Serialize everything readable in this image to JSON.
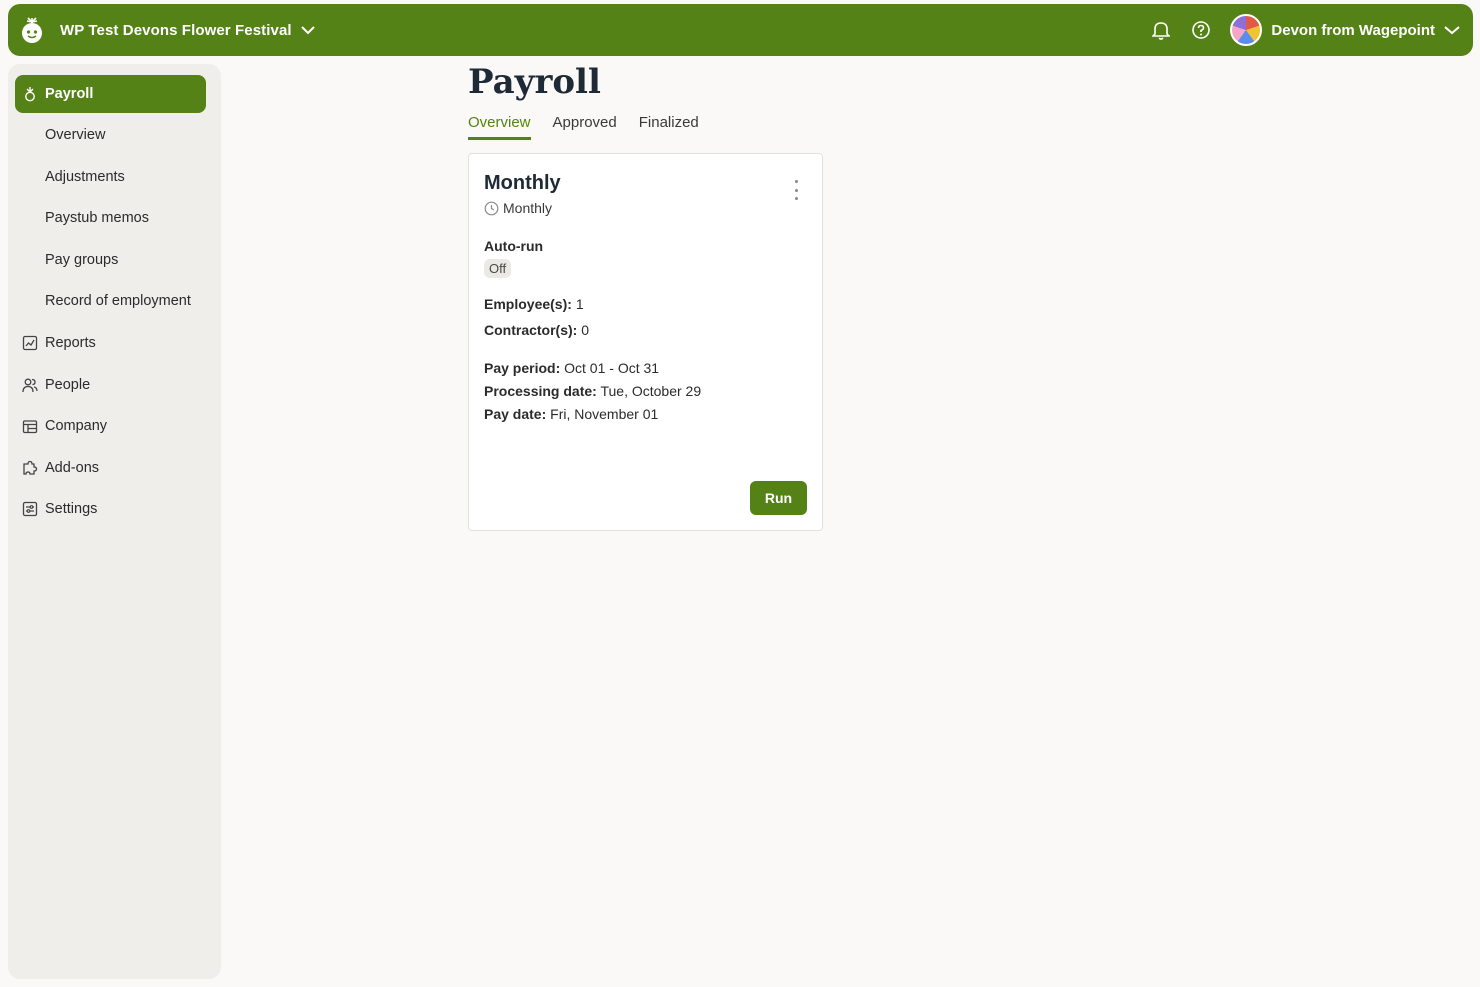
{
  "header": {
    "company_name": "WP Test Devons Flower Festival",
    "user_name": "Devon from Wagepoint",
    "brand_color": "#548216"
  },
  "sidebar": {
    "items": [
      {
        "label": "Payroll",
        "icon": "payroll-icon",
        "active": true
      },
      {
        "label": "Overview"
      },
      {
        "label": "Adjustments"
      },
      {
        "label": "Paystub memos"
      },
      {
        "label": "Pay groups"
      },
      {
        "label": "Record of employment"
      },
      {
        "label": "Reports",
        "icon": "reports-icon"
      },
      {
        "label": "People",
        "icon": "people-icon"
      },
      {
        "label": "Company",
        "icon": "company-icon"
      },
      {
        "label": "Add-ons",
        "icon": "addons-icon"
      },
      {
        "label": "Settings",
        "icon": "settings-icon"
      }
    ]
  },
  "main": {
    "title": "Payroll",
    "tabs": [
      {
        "label": "Overview",
        "active": true
      },
      {
        "label": "Approved"
      },
      {
        "label": "Finalized"
      }
    ],
    "card": {
      "title": "Monthly",
      "frequency": "Monthly",
      "autorun_label": "Auto-run",
      "autorun_value": "Off",
      "employees_label": "Employee(s):",
      "employees_value": "1",
      "contractors_label": "Contractor(s):",
      "contractors_value": "0",
      "pay_period_label": "Pay period:",
      "pay_period_value": "Oct 01 - Oct 31",
      "processing_label": "Processing date:",
      "processing_value": "Tue, October 29",
      "pay_date_label": "Pay date:",
      "pay_date_value": "Fri, November 01",
      "run_label": "Run"
    }
  }
}
